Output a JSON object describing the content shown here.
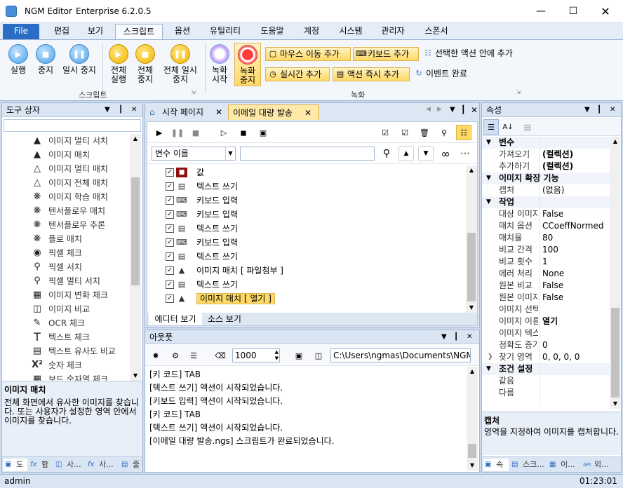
{
  "window": {
    "app_name": "NGM Editor",
    "edition": "Enterprise 6.2.0.5"
  },
  "ribbon_tabs": [
    "File",
    "편집",
    "보기",
    "스크립트",
    "옵션",
    "유틸리티",
    "도움말",
    "계정",
    "시스템",
    "관리자",
    "스폰서"
  ],
  "ribbon": {
    "script_group": {
      "label": "스크립트",
      "buttons": [
        "실행",
        "중지",
        "일시 중지",
        "전체 실행",
        "전체 중지",
        "전체 일시 중지"
      ]
    },
    "record_group": {
      "label": "녹화",
      "record_start": "녹화 시작",
      "record_stop": "녹화 중지",
      "mouse_move": "마우스 이동 추가",
      "keyboard": "키보드 추가",
      "add_in_selected": "선택한 액션 안에 추가",
      "realtime": "실시간 추가",
      "instant_action": "액션 즉시 추가",
      "event_complete": "이벤트 완료"
    }
  },
  "toolbox": {
    "title": "도구 상자",
    "items": [
      "이미지 멀티 서치",
      "이미지 매치",
      "이미지 멀티 매치",
      "이미지 전체 매치",
      "이미지 학습 매치",
      "텐서플로우 매치",
      "텐서플로우 추론",
      "플로 매치",
      "픽셀 체크",
      "픽셀 서치",
      "픽셀 멀티 서치",
      "이미지 변화 체크",
      "이미지 비교",
      "OCR 체크",
      "텍스트 체크",
      "텍스트 유사도 비교",
      "숫자 체크",
      "보드 숫자열 체크"
    ],
    "desc_title": "이미지 매치",
    "desc_text": "전체 화면에서 유사한 이미지를 찾습니다. 또는 사용자가 설정한 영역 안에서 이미지를 찾습니다.",
    "bottom_tabs": [
      "도",
      "함",
      "사...",
      "사...",
      "줄"
    ]
  },
  "document": {
    "tabs": [
      "시작 페이지",
      "이메일 대량 발송"
    ],
    "search_dropdown": "변수 이름",
    "search_value": "",
    "actions": [
      {
        "label": "값",
        "icon": "variable"
      },
      {
        "label": "텍스트 쓰기",
        "icon": "text"
      },
      {
        "label": "키보드 입력",
        "icon": "keyboard"
      },
      {
        "label": "키보드 입력",
        "icon": "keyboard"
      },
      {
        "label": "텍스트 쓰기",
        "icon": "text"
      },
      {
        "label": "키보드 입력",
        "icon": "keyboard"
      },
      {
        "label": "텍스트 쓰기",
        "icon": "text"
      },
      {
        "label": "이미지 매치 [ 파일첨부 ]",
        "icon": "image-match"
      },
      {
        "label": "텍스트 쓰기",
        "icon": "text"
      },
      {
        "label": "이미지 매치 [ 열기 ]",
        "icon": "image-match"
      }
    ],
    "view_tabs": [
      "에디터 보기",
      "소스 보기"
    ]
  },
  "output": {
    "title": "아웃풋",
    "count_value": "1000",
    "path": "C:\\Users\\ngmas\\Documents\\NGM6\\",
    "lines": [
      "[키 코드] TAB",
      "[텍스트 쓰기] 액션이 시작되었습니다.",
      "[키보드 입력] 액션이 시작되었습니다.",
      "[키 코드] TAB",
      "[텍스트 쓰기] 액션이 시작되었습니다.",
      "[이메일 대량 발송.ngs] 스크립트가 완료되었습니다."
    ]
  },
  "properties": {
    "title": "속성",
    "categories": [
      {
        "name": "변수",
        "rows": [
          [
            "가져오기",
            "(컬렉션)"
          ],
          [
            "추가하기",
            "(컬렉션)"
          ]
        ]
      },
      {
        "name": "이미지 확장 기능",
        "rows": [
          [
            "캡처",
            "(없음)"
          ]
        ]
      },
      {
        "name": "작업",
        "rows": [
          [
            "대상 이미지",
            "False"
          ],
          [
            "매치 옵션",
            "CCoeffNormed"
          ],
          [
            "매치율",
            "80"
          ],
          [
            "비교 간격",
            "100"
          ],
          [
            "비교 횟수",
            "1"
          ],
          [
            "에러 처리",
            "None"
          ],
          [
            "원본 비교",
            "False"
          ],
          [
            "원본 이미지",
            "False"
          ],
          [
            "이미지 선택",
            ""
          ],
          [
            "이미지 이름",
            "열기"
          ],
          [
            "이미지 텍스트",
            ""
          ],
          [
            "정확도 증가",
            "0"
          ],
          [
            "찾기 영역",
            "0, 0, 0, 0"
          ]
        ]
      },
      {
        "name": "조건 설정",
        "rows": [
          [
            "같음",
            ""
          ],
          [
            "다름",
            ""
          ]
        ]
      }
    ],
    "desc_title": "캡처",
    "desc_text": "영역을 지정하여 이미지를 캡처합니다.",
    "bottom_tabs": [
      "속",
      "스크...",
      "이...",
      "외..."
    ]
  },
  "status": {
    "user": "admin",
    "time": "01:23:01"
  },
  "colors": {
    "accent": "#2b6cc4",
    "highlight": "#ffd966"
  }
}
